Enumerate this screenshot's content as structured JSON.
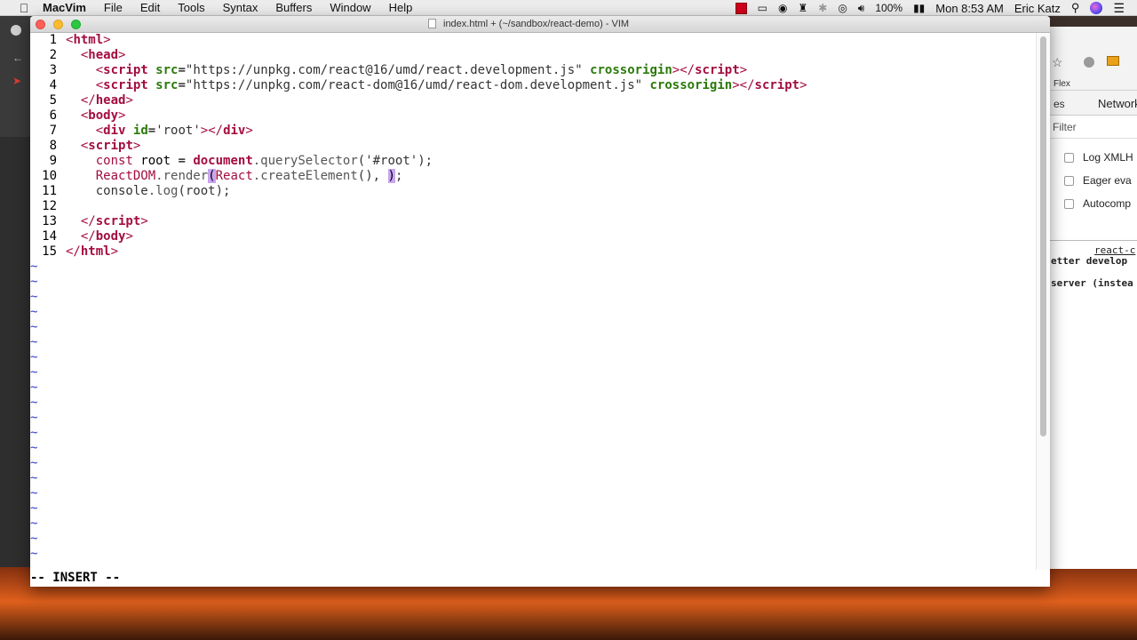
{
  "menubar": {
    "app_name": "MacVim",
    "items": [
      "File",
      "Edit",
      "Tools",
      "Syntax",
      "Buffers",
      "Window",
      "Help"
    ],
    "battery": "100%",
    "clock": "Mon 8:53 AM",
    "user": "Eric Katz",
    "icons": [
      "apple-icon",
      "record-icon",
      "screen-icon",
      "camera-icon",
      "cat-icon",
      "bluetooth-icon",
      "wifi-icon",
      "volume-icon",
      "battery-icon",
      "search-icon",
      "siri-icon",
      "list-icon"
    ]
  },
  "window": {
    "title": "index.html + (~/sandbox/react-demo) - VIM"
  },
  "editor": {
    "lines": [
      {
        "n": "1"
      },
      {
        "n": "2"
      },
      {
        "n": "3"
      },
      {
        "n": "4"
      },
      {
        "n": "5"
      },
      {
        "n": "6"
      },
      {
        "n": "7"
      },
      {
        "n": "8"
      },
      {
        "n": "9"
      },
      {
        "n": "10"
      },
      {
        "n": "11"
      },
      {
        "n": "12"
      },
      {
        "n": "13"
      },
      {
        "n": "14"
      },
      {
        "n": "15"
      }
    ],
    "text": {
      "l1_tag": "html",
      "l2_tag": "head",
      "l3_tag": "script",
      "l3_attr": "src",
      "l3_val": "\"https://unpkg.com/react@16/umd/react.development.js\"",
      "l3_attr2": "crossorigin",
      "l3_close": "script",
      "l4_tag": "script",
      "l4_attr": "src",
      "l4_val": "\"https://unpkg.com/react-dom@16/umd/react-dom.development.js\"",
      "l4_attr2": "crossorigin",
      "l4_close": "script",
      "l5_tag": "head",
      "l6_tag": "body",
      "l7_tag": "div",
      "l7_attr": "id",
      "l7_val": "'root'",
      "l7_close": "div",
      "l8_tag": "script",
      "l9_const": "const",
      "l9_rest1": " root = ",
      "l9_obj": "document",
      "l9_method": ".querySelector",
      "l9_rest2": "('#root');",
      "l10_obj": "ReactDOM",
      "l10_method": ".render",
      "l10_paren": "(",
      "l10_react": "React",
      "l10_method2": ".createElement",
      "l10_rest": "(), ",
      "l10_cursor": ")",
      "l10_end": ";",
      "l11_obj": "console",
      "l11_method": ".log",
      "l11_rest": "(root);",
      "l13_tag": "script",
      "l14_tag": "body",
      "l15_tag": "html"
    },
    "empty_marker": "~",
    "mode": "-- INSERT --"
  },
  "background_window": {
    "flex_label": "Flex",
    "es_label": "es",
    "network_label": "Network",
    "filter_label": "Filter",
    "options": [
      "Log XMLH",
      "Eager eva",
      "Autocomp"
    ],
    "console_link": "react-c",
    "console_line1": "etter develop",
    "console_line2": "server (instea"
  }
}
